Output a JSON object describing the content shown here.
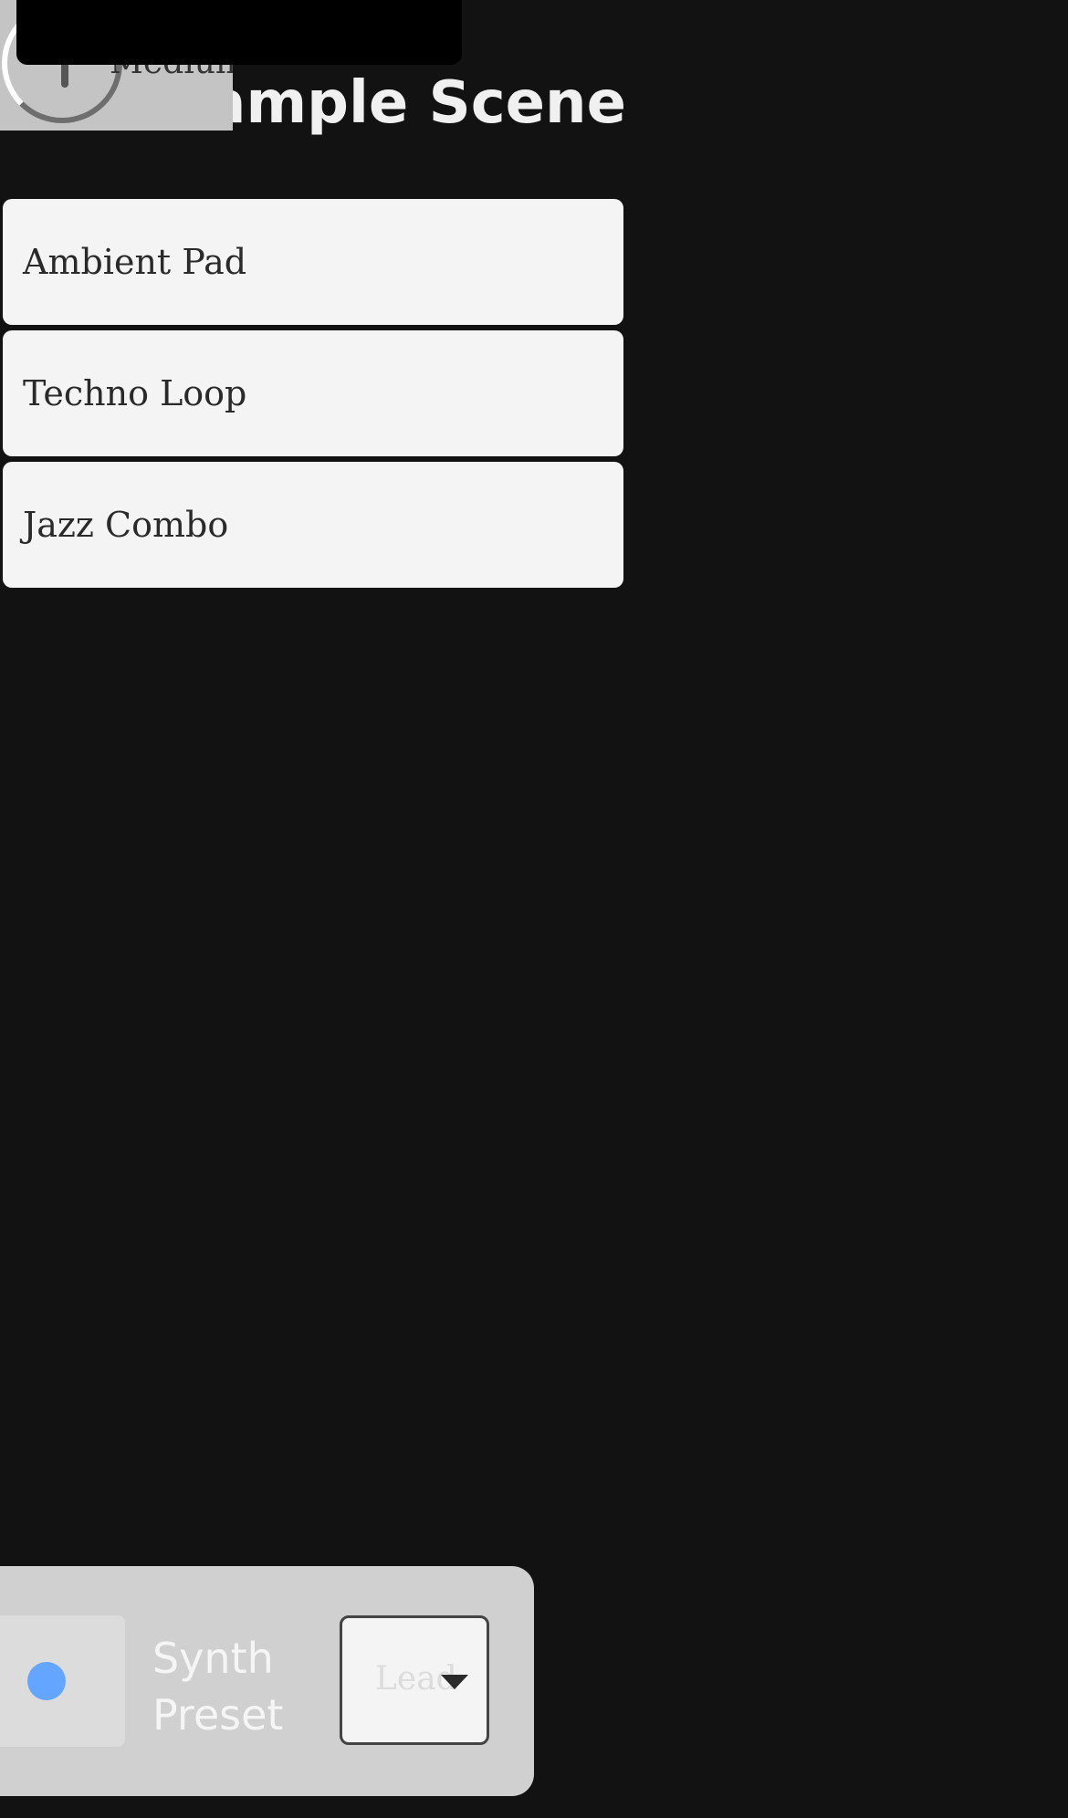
{
  "header": {
    "title": "Example Scene",
    "quality_label": "Medium"
  },
  "scenes": [
    {
      "label": "Ambient Pad"
    },
    {
      "label": "Techno Loop"
    },
    {
      "label": "Jazz Combo"
    }
  ],
  "bottom_panel": {
    "preset_label": "Synth Preset",
    "preset_value": "Lead",
    "dot_color": "#64a6ff"
  },
  "colors": {
    "background": "#121212",
    "card": "#f4f4f4",
    "panel": "#d0d0d0"
  }
}
